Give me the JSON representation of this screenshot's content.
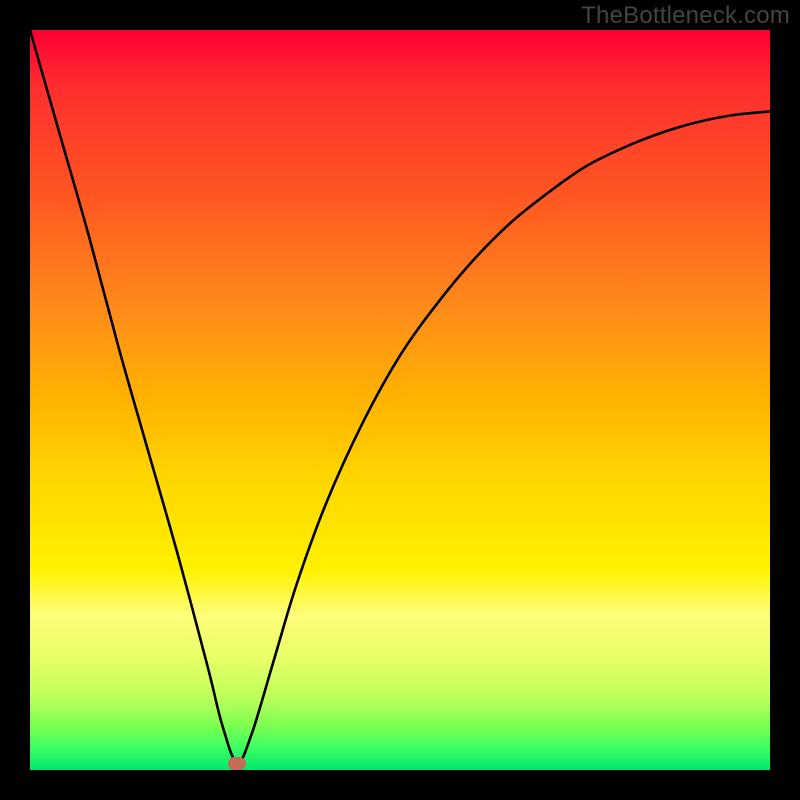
{
  "watermark": "TheBottleneck.com",
  "chart_data": {
    "type": "line",
    "title": "",
    "xlabel": "",
    "ylabel": "",
    "xlim": [
      0,
      100
    ],
    "ylim": [
      0,
      100
    ],
    "minimum_x": 28,
    "marker_color": "#c26b56",
    "series": [
      {
        "name": "bottleneck-curve",
        "x": [
          0,
          4,
          8,
          12,
          16,
          20,
          24,
          26,
          28,
          30,
          33,
          36,
          40,
          45,
          50,
          55,
          60,
          65,
          70,
          75,
          80,
          85,
          90,
          95,
          100
        ],
        "values": [
          100,
          86,
          72,
          57,
          43,
          29,
          14,
          6,
          1,
          5,
          15,
          25,
          36,
          47,
          56,
          63,
          69,
          74,
          78,
          81.5,
          84,
          86,
          87.5,
          88.5,
          89
        ]
      }
    ],
    "gradient_stops": [
      {
        "pos": 0,
        "color": "#ff0033"
      },
      {
        "pos": 8,
        "color": "#ff2f2f"
      },
      {
        "pos": 22,
        "color": "#ff5522"
      },
      {
        "pos": 38,
        "color": "#ff8c1a"
      },
      {
        "pos": 50,
        "color": "#ffb300"
      },
      {
        "pos": 60,
        "color": "#ffd400"
      },
      {
        "pos": 68,
        "color": "#ffe600"
      },
      {
        "pos": 73,
        "color": "#fff200"
      },
      {
        "pos": 79,
        "color": "#fdfe7a"
      },
      {
        "pos": 85,
        "color": "#e8ff66"
      },
      {
        "pos": 90,
        "color": "#bfff5a"
      },
      {
        "pos": 94,
        "color": "#7cff52"
      },
      {
        "pos": 97,
        "color": "#3dff62"
      },
      {
        "pos": 100,
        "color": "#00e66b"
      }
    ]
  }
}
